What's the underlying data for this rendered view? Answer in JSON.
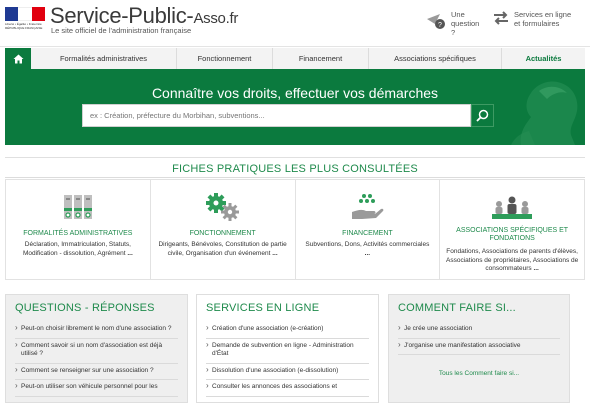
{
  "header": {
    "brand_main": "Service-Public-",
    "brand_asso": "Asso",
    "brand_tld": ".fr",
    "tagline": "Le site officiel de l'administration française",
    "flag_text": "Liberté • Égalité • Fraternité RÉPUBLIQUE FRANÇAISE",
    "question_label": "Une question ?",
    "services_label": "Services en ligne et formulaires"
  },
  "nav": {
    "home_icon": "home-icon",
    "items": [
      "Formalités administratives",
      "Fonctionnement",
      "Financement",
      "Associations spécifiques",
      "Actualités"
    ]
  },
  "hero": {
    "title": "Connaître vos droits, effectuer vos démarches",
    "search_placeholder": "ex : Création, préfecture du Morbihan, subventions..."
  },
  "fiches": {
    "title": "FICHES PRATIQUES LES PLUS CONSULTÉES",
    "cards": [
      {
        "icon": "binders-icon",
        "title": "FORMALITÉS ADMINISTRATIVES",
        "desc": "Déclaration, Immatriculation, Statuts, Modification - dissolution, Agrément",
        "more": "..."
      },
      {
        "icon": "gears-icon",
        "title": "FONCTIONNEMENT",
        "desc": "Dirigeants, Bénévoles, Constitution de partie civile, Organisation d'un événement",
        "more": "..."
      },
      {
        "icon": "money-hand-icon",
        "title": "FINANCEMENT",
        "desc": "Subventions, Dons, Activités commerciales",
        "more": "..."
      },
      {
        "icon": "group-icon",
        "title": "ASSOCIATIONS SPÉCIFIQUES ET FONDATIONS",
        "desc": "Fondations, Associations de parents d'élèves, Associations de propriétaires, Associations de consommateurs",
        "more": "..."
      }
    ]
  },
  "questions": {
    "title": "QUESTIONS - RÉPONSES",
    "items": [
      "Peut-on choisir librement le nom d'une association ?",
      "Comment savoir si un nom d'association est déjà utilisé ?",
      "Comment se renseigner sur une association ?",
      "Peut-on utiliser son véhicule personnel pour les"
    ]
  },
  "services": {
    "title": "SERVICES EN LIGNE",
    "items": [
      "Création d'une association (e-création)",
      "Demande de subvention en ligne - Administration d'État",
      "Dissolution d'une association (e-dissolution)",
      "Consulter les annonces des associations et"
    ]
  },
  "comment": {
    "title": "COMMENT FAIRE SI...",
    "items": [
      "Je crée une association",
      "J'organise une manifestation associative"
    ],
    "all_link": "Tous les Comment faire si..."
  },
  "colors": {
    "green": "#0b7a3e",
    "title_green": "#1f8a4c"
  }
}
